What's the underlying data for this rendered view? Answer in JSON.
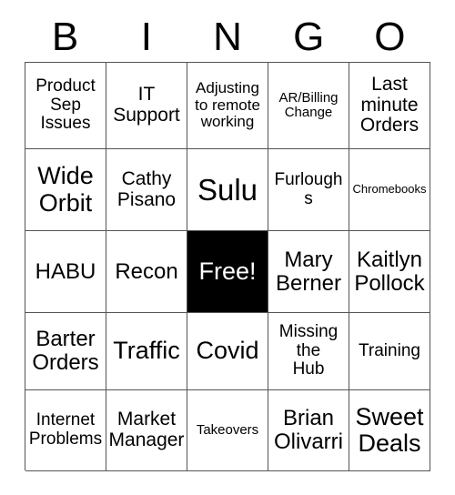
{
  "card": {
    "title": "BINGO",
    "header_letters": [
      "B",
      "I",
      "N",
      "G",
      "O"
    ],
    "columns": 5,
    "rows": 5,
    "colors": {
      "background": "#ffffff",
      "text": "#000000",
      "grid_line": "#555555",
      "marked_background": "#000000",
      "marked_text": "#ffffff"
    },
    "cells": [
      [
        {
          "text": "Product\nSep\nIssues",
          "size": "m",
          "marked": false
        },
        {
          "text": "IT\nSupport",
          "size": "ml",
          "marked": false
        },
        {
          "text": "Adjusting\nto remote\nworking",
          "size": "sm",
          "marked": false
        },
        {
          "text": "AR/Billing\nChange",
          "size": "s",
          "marked": false
        },
        {
          "text": "Last\nminute\nOrders",
          "size": "ml",
          "marked": false
        }
      ],
      [
        {
          "text": "Wide\nOrbit",
          "size": "xl",
          "marked": false
        },
        {
          "text": "Cathy\nPisano",
          "size": "ml",
          "marked": false
        },
        {
          "text": "Sulu",
          "size": "xxl",
          "marked": false
        },
        {
          "text": "Furloughs",
          "size": "m",
          "marked": false
        },
        {
          "text": "Chromebooks",
          "size": "xs",
          "marked": false
        }
      ],
      [
        {
          "text": "HABU",
          "size": "l",
          "marked": false
        },
        {
          "text": "Recon",
          "size": "l",
          "marked": false
        },
        {
          "text": "Free!",
          "size": "xl",
          "marked": true
        },
        {
          "text": "Mary\nBerner",
          "size": "l",
          "marked": false
        },
        {
          "text": "Kaitlyn\nPollock",
          "size": "l",
          "marked": false
        }
      ],
      [
        {
          "text": "Barter\nOrders",
          "size": "l",
          "marked": false
        },
        {
          "text": "Traffic",
          "size": "xl",
          "marked": false
        },
        {
          "text": "Covid",
          "size": "xl",
          "marked": false
        },
        {
          "text": "Missing\nthe\nHub",
          "size": "m",
          "marked": false
        },
        {
          "text": "Training",
          "size": "m",
          "marked": false
        }
      ],
      [
        {
          "text": "Internet\nProblems",
          "size": "m",
          "marked": false
        },
        {
          "text": "Market\nManager",
          "size": "ml",
          "marked": false
        },
        {
          "text": "Takeovers",
          "size": "s",
          "marked": false
        },
        {
          "text": "Brian\nOlivarri",
          "size": "l",
          "marked": false
        },
        {
          "text": "Sweet\nDeals",
          "size": "xl",
          "marked": false
        }
      ]
    ]
  }
}
